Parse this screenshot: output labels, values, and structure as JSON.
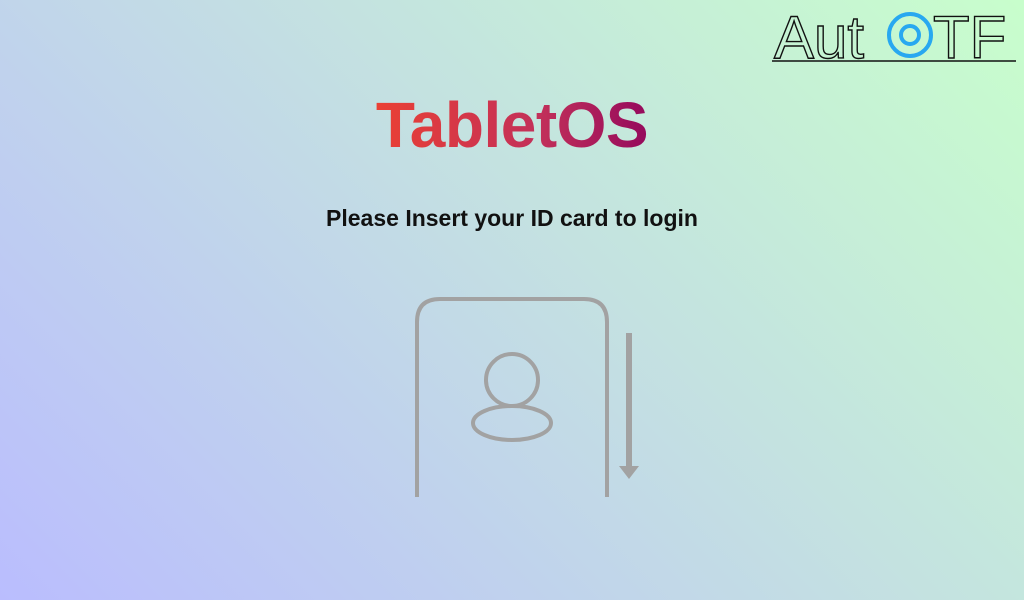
{
  "brand": {
    "logo_text": "AutOTF",
    "logo_parts": {
      "left": "Aut",
      "right": "TF"
    },
    "icon": "target-o-icon",
    "accent_color": "#28a8f0"
  },
  "app": {
    "title": "TabletOS",
    "title_gradient": [
      "#ea4034",
      "#950a5c"
    ]
  },
  "login": {
    "prompt": "Please Insert your ID card to login",
    "illustration_icon": "id-card-insert-icon",
    "arrow_icon": "arrow-down-icon",
    "avatar_icon": "user-silhouette-icon",
    "illustration_color": "#a2a2a2"
  },
  "background": {
    "gradient": [
      "#babdfe",
      "#c3dde4",
      "#c8fecc"
    ]
  }
}
